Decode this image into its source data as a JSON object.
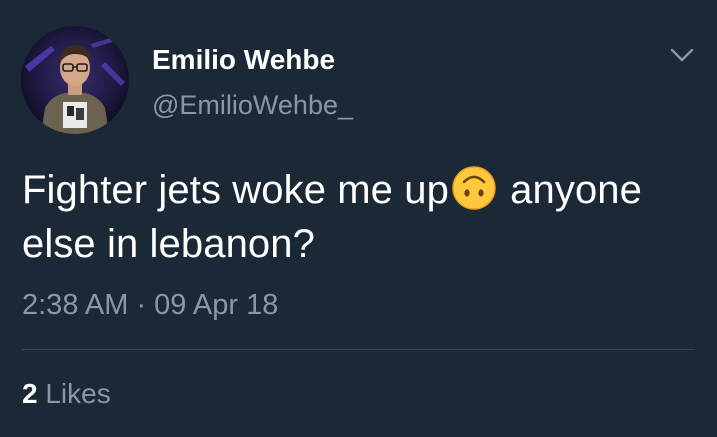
{
  "user": {
    "display_name": "Emilio Wehbe",
    "handle": "@EmilioWehbe_",
    "avatar_icon": "profile-photo"
  },
  "menu": {
    "icon": "chevron-down-icon"
  },
  "tweet": {
    "line1_before_emoji": "Fighter jets woke me up",
    "emoji": "upside-down-face-emoji",
    "line1_after_emoji": "anyone",
    "line2": "else in lebanon?"
  },
  "meta": {
    "timestamp": "2:38 AM · 09 Apr 18"
  },
  "stats": {
    "likes_count": "2",
    "likes_label": "Likes"
  },
  "colors": {
    "background": "#1b2836",
    "primary_text": "#ffffff",
    "secondary_text": "#8899a6",
    "divider": "#38444d",
    "emoji": "#ffc83d"
  }
}
